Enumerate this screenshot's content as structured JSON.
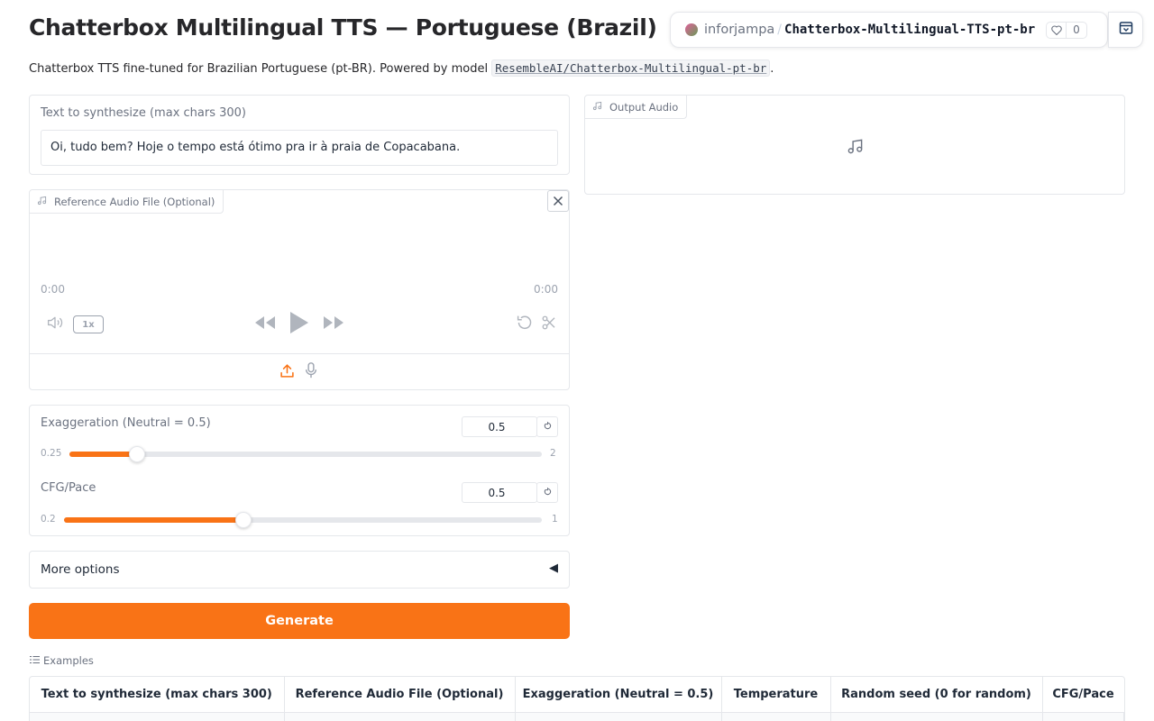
{
  "header": {
    "title": "Chatterbox Multilingual TTS — Portuguese (Brazil)",
    "subtitle_prefix": "Chatterbox TTS fine-tuned for Brazilian Portuguese (pt-BR). Powered by model",
    "model_link": "ResembleAI/Chatterbox-Multilingual-pt-br",
    "subtitle_suffix": "."
  },
  "hf_badge": {
    "user": "inforjampa",
    "separator": "/",
    "space": "Chatterbox-Multilingual-TTS-pt-br",
    "likes": "0"
  },
  "text_input": {
    "label": "Text to synthesize (max chars 300)",
    "value": "Oi, tudo bem? Hoje o tempo está ótimo pra ir à praia de Copacabana."
  },
  "reference_audio": {
    "label": "Reference Audio File (Optional)",
    "time_current": "0:00",
    "time_total": "0:00",
    "speed": "1x"
  },
  "sliders": [
    {
      "label": "Exaggeration (Neutral = 0.5)",
      "value": "0.5",
      "min": "0.25",
      "max": "2",
      "fraction": 0.143
    },
    {
      "label": "CFG/Pace",
      "value": "0.5",
      "min": "0.2",
      "max": "1",
      "fraction": 0.375
    }
  ],
  "more_options": {
    "label": "More options",
    "arrow": "◀"
  },
  "generate_button": "Generate",
  "output_audio": {
    "label": "Output Audio"
  },
  "examples": {
    "label": "Examples",
    "headers": [
      "Text to synthesize (max chars 300)",
      "Reference Audio File (Optional)",
      "Exaggeration (Neutral = 0.5)",
      "Temperature",
      "Random seed (0 for random)",
      "CFG/Pace"
    ]
  },
  "colors": {
    "accent": "#f97316"
  }
}
